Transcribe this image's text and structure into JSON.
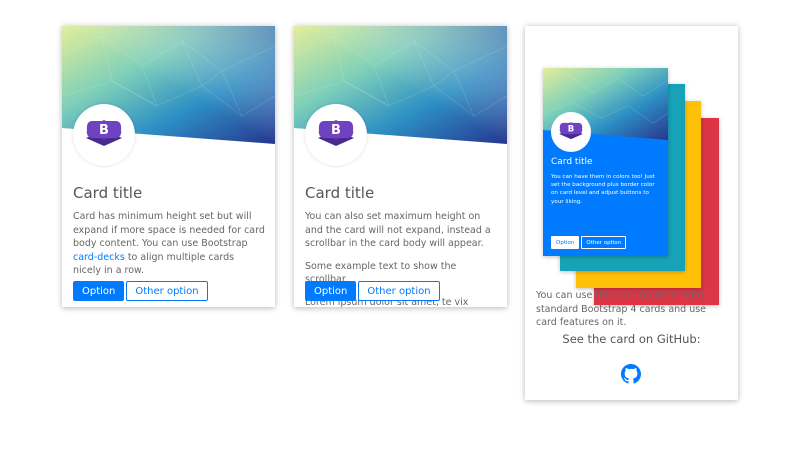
{
  "cards": [
    {
      "title": "Card title",
      "text_before_link": "Card has minimum height set but will expand if more space is needed for card body content. You can use Bootstrap ",
      "link_text": "card-decks",
      "text_after_link": " to align multiple cards nicely in a row.",
      "buttons": {
        "primary": "Option",
        "secondary": "Other option"
      },
      "logo_letter": "B"
    },
    {
      "title": "Card title",
      "paragraphs": [
        "You can also set maximum height on and the card will not expand, instead a scrollbar in the card body will appear.",
        "Some example text to show the scrollbar.",
        "Lorem ipsum dolor sit amet, te vix omittam fastidii, enim paulo omnes ea has, illud"
      ],
      "buttons": {
        "primary": "Option",
        "secondary": "Other option"
      },
      "logo_letter": "B"
    },
    {
      "mini_card": {
        "title": "Card title",
        "text": "You can have them in colors too! Just set the background plus border color on card level and adjust buttons to your liking.",
        "buttons": {
          "primary": "Option",
          "secondary": "Other option"
        },
        "logo_letter": "B"
      },
      "stack_colors": [
        "#007bff",
        "#17a2b8",
        "#ffc107",
        "#dc3545"
      ],
      "text": "You can use this card together with standard Bootstrap 4 cards and use card features on it.",
      "github_label": "See the card on GitHub:",
      "github_icon": "github-icon"
    }
  ],
  "colors": {
    "primary": "#007bff",
    "logo_purple": "#6f42c1"
  }
}
